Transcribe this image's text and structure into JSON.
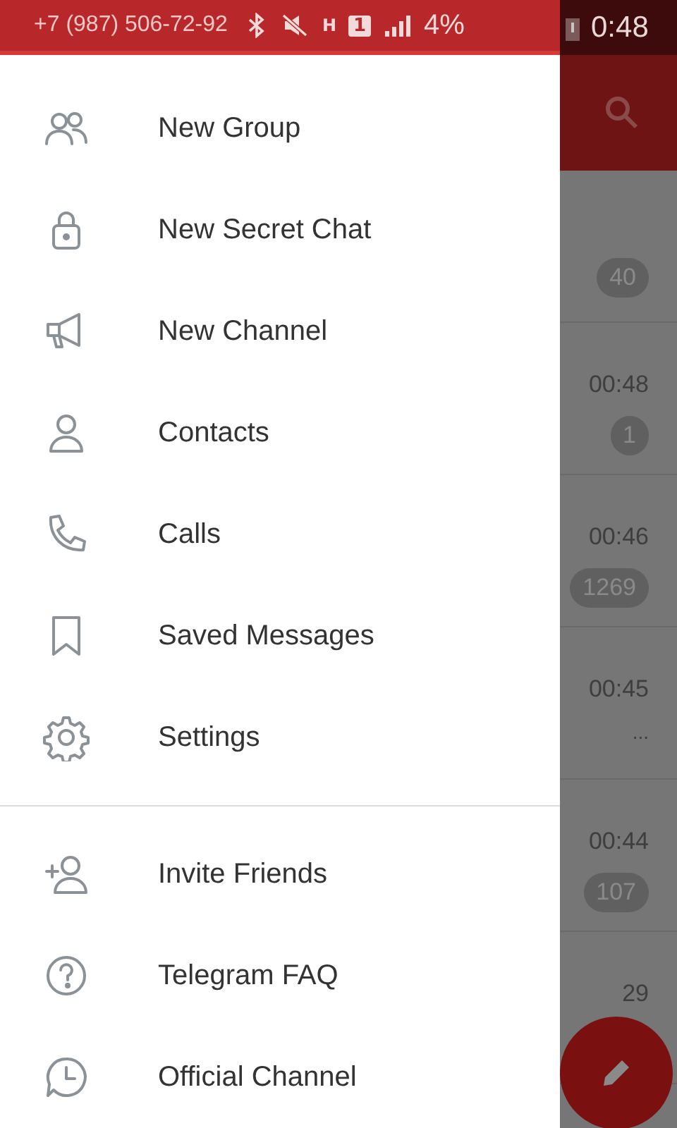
{
  "status_bar": {
    "phone": "+7 (987) 506-72-92",
    "network": "H",
    "sim": "1",
    "battery": "4%",
    "time": "0:48"
  },
  "drawer": {
    "sections": [
      {
        "items": [
          {
            "label": "New Group"
          },
          {
            "label": "New Secret Chat"
          },
          {
            "label": "New Channel"
          },
          {
            "label": "Contacts"
          },
          {
            "label": "Calls"
          },
          {
            "label": "Saved Messages"
          },
          {
            "label": "Settings"
          }
        ]
      },
      {
        "items": [
          {
            "label": "Invite Friends"
          },
          {
            "label": "Telegram FAQ"
          },
          {
            "label": "Official Channel"
          }
        ]
      }
    ]
  },
  "chat_list": {
    "rows": [
      {
        "time": "",
        "badge": "40"
      },
      {
        "time": "00:48",
        "badge": "1"
      },
      {
        "time": "00:46",
        "badge": "1269"
      },
      {
        "time": "00:45",
        "preview": "..."
      },
      {
        "time": "00:44",
        "badge": "107"
      },
      {
        "time": "29"
      }
    ]
  }
}
